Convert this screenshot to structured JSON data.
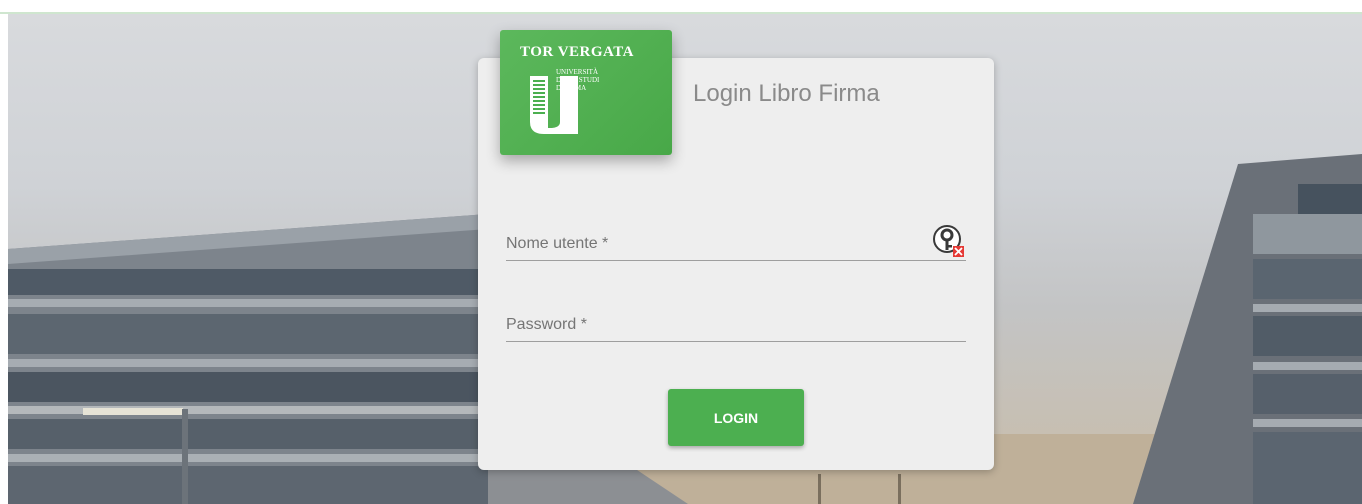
{
  "brand": {
    "name": "TOR VERGATA",
    "subtitle_lines": [
      "UNIVERSITÀ",
      "DEGLI STUDI",
      "DI ROMA"
    ],
    "color": "#4caf50"
  },
  "login": {
    "title": "Login Libro Firma",
    "username_placeholder": "Nome utente *",
    "password_placeholder": "Password *",
    "button_label": "LOGIN",
    "password_manager_icon": "key-icon"
  }
}
